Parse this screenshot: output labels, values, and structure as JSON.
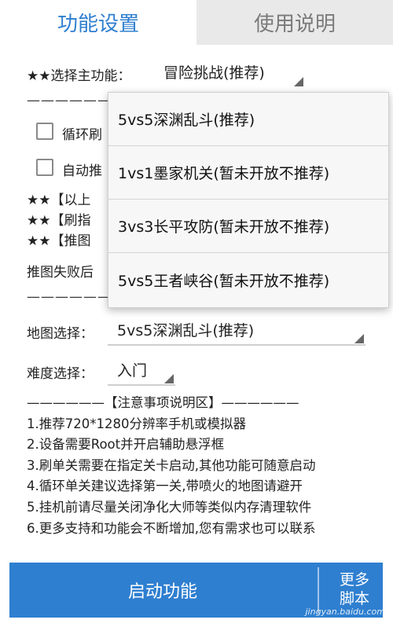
{
  "tabs": [
    {
      "label": "功能设置",
      "active": true
    },
    {
      "label": "使用说明",
      "active": false
    }
  ],
  "main_function": {
    "label": "★★选择主功能：",
    "value": "冒险挑战(推荐)"
  },
  "separator_top": "——————",
  "checkboxes": [
    {
      "label": "循环刷",
      "checked": false
    },
    {
      "label": "自动推",
      "checked": false
    }
  ],
  "star_lines": [
    "★★【以上",
    "★★【刷指",
    "★★【推图"
  ],
  "fail_label": "推图失败后",
  "separator_mid": "——————",
  "map_select": {
    "label": "地图选择：",
    "value": "5vs5深渊乱斗(推荐)"
  },
  "difficulty_select": {
    "label": "难度选择：",
    "value": "入门"
  },
  "notes": {
    "header": "——————【注意事项说明区】——————",
    "items": [
      "1.推荐720*1280分辨率手机或模拟器",
      "2.设备需要Root并开启辅助悬浮框",
      "3.刷单关需要在指定关卡启动,其他功能可随意启动",
      "4.循环单关建议选择第一关,带喷火的地图请避开",
      "5.挂机前请尽量关闭净化大师等类似内存清理软件",
      "6.更多支持和功能会不断增加,您有需求也可以联系"
    ]
  },
  "start_button": "启动功能",
  "more_button": {
    "line1": "更多",
    "line2": "脚本"
  },
  "dropdown": {
    "options": [
      "5vs5深渊乱斗(推荐)",
      "1vs1墨家机关(暂未开放不推荐)",
      "3vs3长平攻防(暂未开放不推荐)",
      "5vs5王者峡谷(暂未开放不推荐)"
    ]
  },
  "watermark": "jingyan.baidu.com",
  "colors": {
    "accent": "#2f7fd0",
    "tab_inactive_bg": "#e9e9e9"
  }
}
